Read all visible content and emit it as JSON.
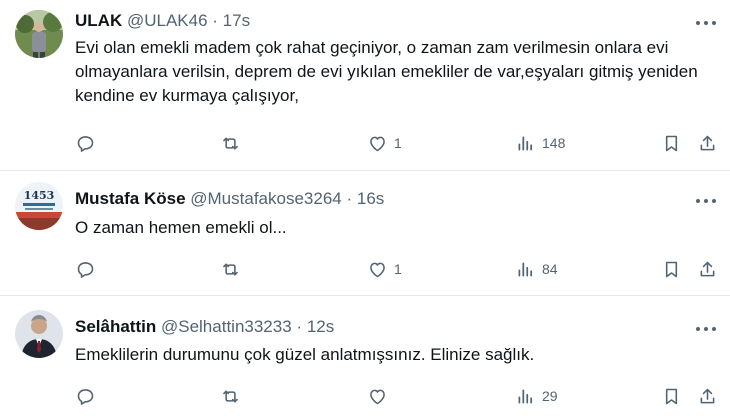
{
  "tweets": [
    {
      "name": "ULAK",
      "handle": "@ULAK46",
      "separator": "·",
      "time": "17s",
      "text": "Evi olan emekli madem çok rahat geçiniyor, o zaman zam verilmesin onlara evi olmayanlara verilsin, deprem de evi yıkılan emekliler de var,eşyaları gitmiş yeniden kendine ev kurmaya çalışıyor,",
      "reply_count": "",
      "retweet_count": "",
      "like_count": "1",
      "view_count": "148"
    },
    {
      "name": "Mustafa Köse",
      "handle": "@Mustafakose3264",
      "separator": "·",
      "time": "16s",
      "text": "O zaman hemen emekli ol...",
      "reply_count": "",
      "retweet_count": "",
      "like_count": "1",
      "view_count": "84"
    },
    {
      "name": "Selâhattin",
      "handle": "@Selhattin33233",
      "separator": "·",
      "time": "12s",
      "text": "Emeklilerin durumunu çok güzel anlatmışsınız. Elinize sağlık.",
      "reply_count": "",
      "retweet_count": "",
      "like_count": "",
      "view_count": "29"
    }
  ],
  "mustafa_avatar_text": "1453",
  "icons": {
    "reply": "reply-icon",
    "retweet": "retweet-icon",
    "like": "heart-icon",
    "views": "views-icon",
    "bookmark": "bookmark-icon",
    "share": "share-icon",
    "more": "more-icon"
  },
  "colors": {
    "text": "#0f1419",
    "secondary": "#536471",
    "divider": "#e5e9ec"
  }
}
